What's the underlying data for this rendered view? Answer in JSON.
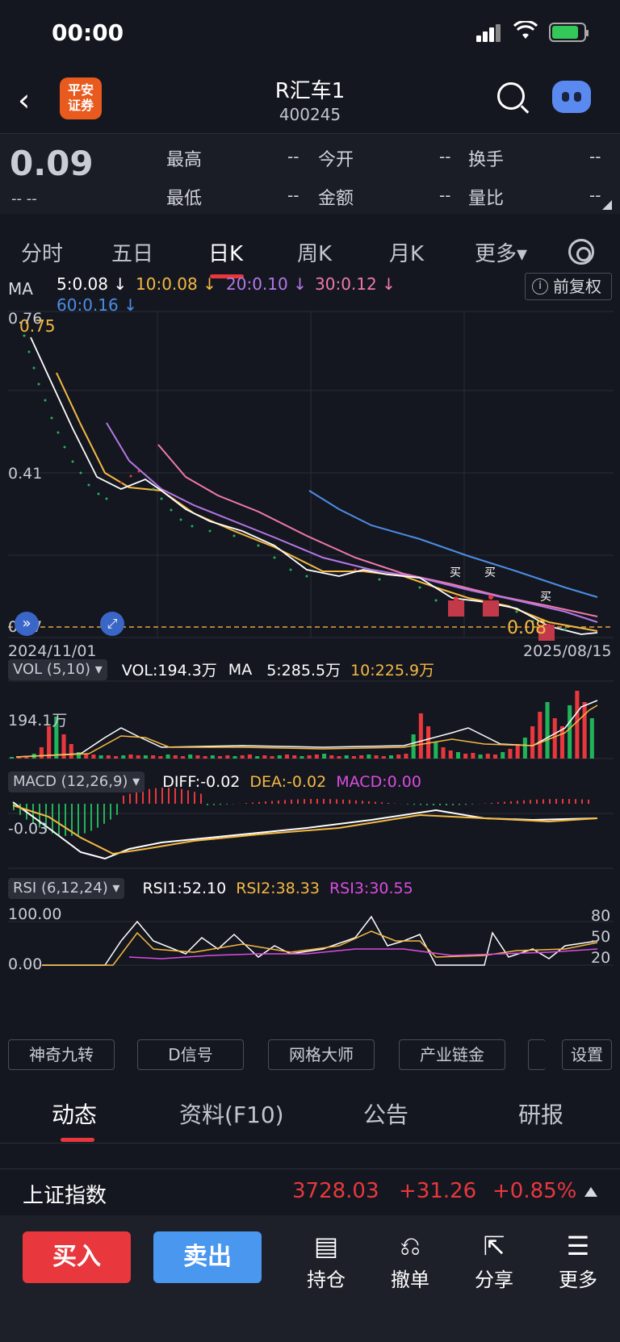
{
  "status": {
    "time": "00:00"
  },
  "header": {
    "title": "R汇车1",
    "code": "400245",
    "logo_line1": "平安",
    "logo_line2": "证券"
  },
  "quote": {
    "price": "0.09",
    "change": "-- --",
    "high_label": "最高",
    "high_val": "--",
    "open_label": "今开",
    "open_val": "--",
    "turnover_label": "换手",
    "turnover_val": "--",
    "low_label": "最低",
    "low_val": "--",
    "amount_label": "金额",
    "amount_val": "--",
    "ratio_label": "量比",
    "ratio_val": "--"
  },
  "tabs": [
    "分时",
    "五日",
    "日K",
    "周K",
    "月K",
    "更多▾"
  ],
  "ma": {
    "label": "MA",
    "ma5": "5:0.08 ↓",
    "ma10": "10:0.08 ↓",
    "ma20": "20:0.10 ↓",
    "ma30": "30:0.12 ↓",
    "ma60": "60:0.16 ↓",
    "adjust": "前复权",
    "y_top": "0.76",
    "y_mid": "0.41",
    "y_bot": "0.07",
    "max_label": "0.75",
    "min_label": "0.08",
    "date_start": "2024/11/01",
    "date_end": "2025/08/15",
    "buy_mark": "买"
  },
  "vol": {
    "tag": "VOL (5,10) ▾",
    "value": "VOL:194.3万",
    "ma_label": "MA",
    "ma5": "5:285.5万",
    "ma10": "10:225.9万",
    "axis": "194.1万"
  },
  "macd": {
    "tag": "MACD (12,26,9) ▾",
    "diff": "DIFF:-0.02",
    "dea": "DEA:-0.02",
    "macd": "MACD:0.00",
    "axis": "-0.03"
  },
  "rsi": {
    "tag": "RSI (6,12,24) ▾",
    "rsi1": "RSI1:52.10",
    "rsi2": "RSI2:38.33",
    "rsi3": "RSI3:30.55",
    "y100": "100.00",
    "y0": "0.00",
    "r80": "80",
    "r50": "50",
    "r20": "20"
  },
  "tools": [
    "神奇九转",
    "D信号",
    "网格大师",
    "产业链金",
    "设置"
  ],
  "infotabs": [
    "动态",
    "资料(F10)",
    "公告",
    "研报"
  ],
  "index": {
    "name": "上证指数",
    "value": "3728.03",
    "change": "+31.26",
    "pct": "+0.85%"
  },
  "bottom": {
    "buy": "买入",
    "sell": "卖出",
    "hold": "持仓",
    "cancel": "撤单",
    "share": "分享",
    "more": "更多"
  },
  "colors": {
    "up": "#e8383d",
    "down": "#21b35a",
    "ma5": "#ffffff",
    "ma10": "#f5b942",
    "ma20": "#b478e8",
    "ma30": "#f07aa8",
    "ma60": "#4a8ee6"
  }
}
